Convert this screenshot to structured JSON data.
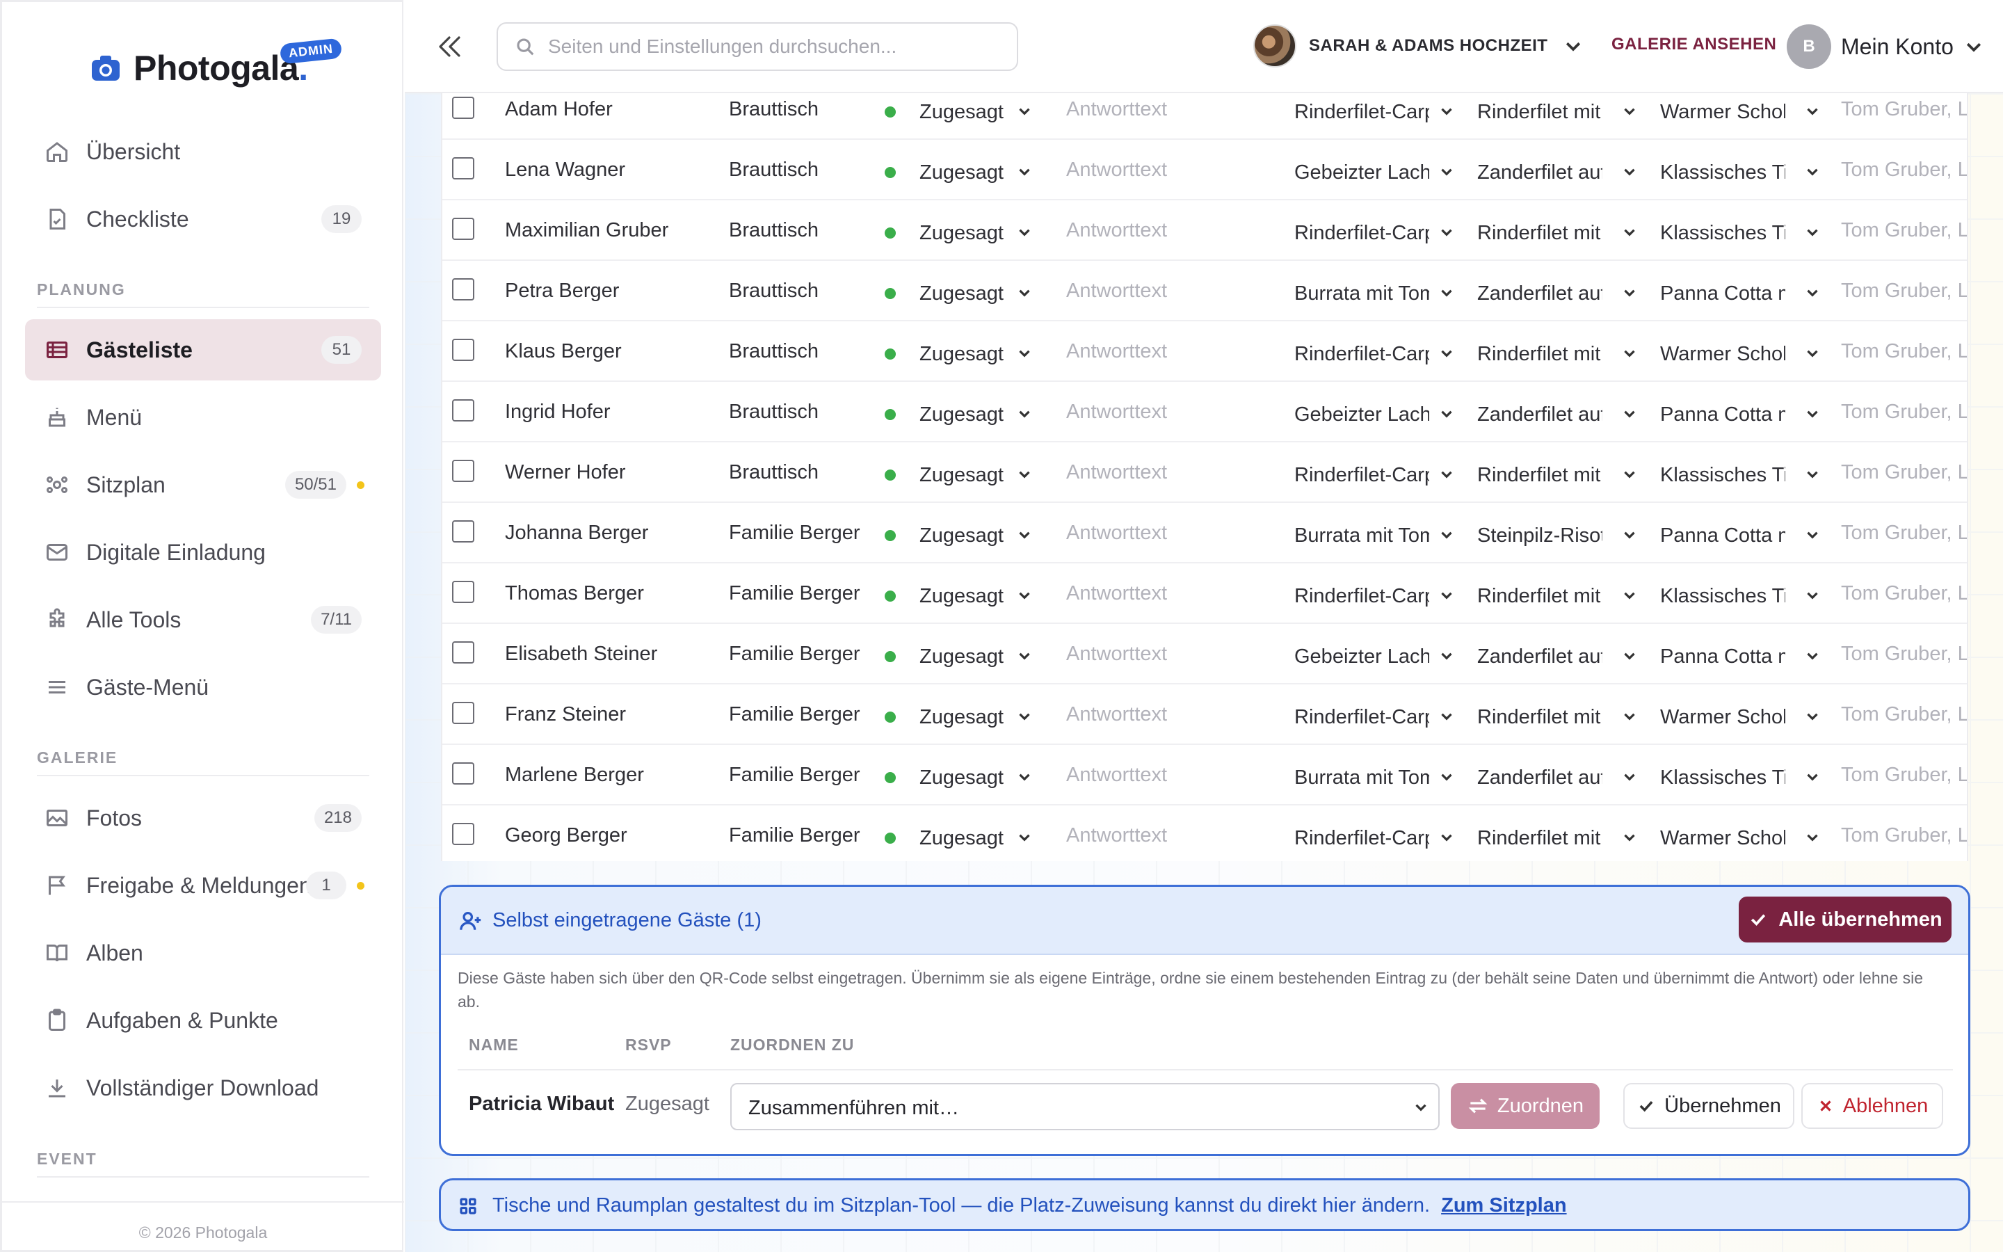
{
  "app": {
    "name": "Photogala",
    "badge": "ADMIN",
    "copyright": "© 2026 Photogala"
  },
  "colors": {
    "brand": "#7a2240",
    "accent_blue": "#2e63d0",
    "status_green": "#3aae4a",
    "notice_dot": "#f3c41a"
  },
  "sidebar": {
    "items": [
      {
        "label": "Übersicht",
        "icon": "home-icon"
      },
      {
        "label": "Checkliste",
        "icon": "checklist-icon",
        "count": "19"
      },
      {
        "label": "Gästeliste",
        "icon": "table-icon",
        "count": "51",
        "active": true
      },
      {
        "label": "Menü",
        "icon": "cake-icon"
      },
      {
        "label": "Sitzplan",
        "icon": "people-icon",
        "count": "50/51",
        "dot": true
      },
      {
        "label": "Digitale Einladung",
        "icon": "mail-icon"
      },
      {
        "label": "Alle Tools",
        "icon": "puzzle-icon",
        "count": "7/11"
      },
      {
        "label": "Gäste-Menü",
        "icon": "menu-icon"
      },
      {
        "label": "Fotos",
        "icon": "image-icon",
        "count": "218"
      },
      {
        "label": "Freigabe & Meldungen",
        "icon": "flag-icon",
        "count": "1",
        "dot": true
      },
      {
        "label": "Alben",
        "icon": "book-icon"
      },
      {
        "label": "Aufgaben & Punkte",
        "icon": "clipboard-icon"
      },
      {
        "label": "Vollständiger Download",
        "icon": "download-icon"
      }
    ],
    "sections": {
      "planung": "PLANUNG",
      "galerie": "GALERIE",
      "event": "EVENT"
    }
  },
  "topbar": {
    "search_placeholder": "Seiten und Einstellungen durchsuchen...",
    "event_name": "SARAH & ADAMS HOCHZEIT",
    "gallery_link": "GALERIE ANSEHEN",
    "account_initial": "B",
    "account_label": "Mein Konto"
  },
  "guests": {
    "response_placeholder": "Antworttext",
    "rows": [
      {
        "name": "Adam Hofer",
        "table": "Brauttisch",
        "rsvp": "Zugesagt",
        "starter": "Rinderfilet-Carpaccio",
        "main": "Rinderfilet mit",
        "dessert": "Warmer Schokokuchen",
        "companions": "Tom Gruber, Lisa"
      },
      {
        "name": "Lena Wagner",
        "table": "Brauttisch",
        "rsvp": "Zugesagt",
        "starter": "Gebeizter Lachs",
        "main": "Zanderfilet auf",
        "dessert": "Klassisches Tiramisu",
        "companions": "Tom Gruber, Lisa"
      },
      {
        "name": "Maximilian Gruber",
        "table": "Brauttisch",
        "rsvp": "Zugesagt",
        "starter": "Rinderfilet-Carpaccio",
        "main": "Rinderfilet mit",
        "dessert": "Klassisches Tiramisu",
        "companions": "Tom Gruber, Lisa"
      },
      {
        "name": "Petra Berger",
        "table": "Brauttisch",
        "rsvp": "Zugesagt",
        "starter": "Burrata mit Tomaten",
        "main": "Zanderfilet auf",
        "dessert": "Panna Cotta mit",
        "companions": "Tom Gruber, Lisa"
      },
      {
        "name": "Klaus Berger",
        "table": "Brauttisch",
        "rsvp": "Zugesagt",
        "starter": "Rinderfilet-Carpaccio",
        "main": "Rinderfilet mit",
        "dessert": "Warmer Schokokuchen",
        "companions": "Tom Gruber, Lisa"
      },
      {
        "name": "Ingrid Hofer",
        "table": "Brauttisch",
        "rsvp": "Zugesagt",
        "starter": "Gebeizter Lachs",
        "main": "Zanderfilet auf",
        "dessert": "Panna Cotta mit",
        "companions": "Tom Gruber, Lisa"
      },
      {
        "name": "Werner Hofer",
        "table": "Brauttisch",
        "rsvp": "Zugesagt",
        "starter": "Rinderfilet-Carpaccio",
        "main": "Rinderfilet mit",
        "dessert": "Klassisches Tiramisu",
        "companions": "Tom Gruber, Lisa"
      },
      {
        "name": "Johanna Berger",
        "table": "Familie Berger",
        "rsvp": "Zugesagt",
        "starter": "Burrata mit Tomaten",
        "main": "Steinpilz-Risotto",
        "dessert": "Panna Cotta mit",
        "companions": "Tom Gruber, Lisa"
      },
      {
        "name": "Thomas Berger",
        "table": "Familie Berger",
        "rsvp": "Zugesagt",
        "starter": "Rinderfilet-Carpaccio",
        "main": "Rinderfilet mit",
        "dessert": "Klassisches Tiramisu",
        "companions": "Tom Gruber, Lisa"
      },
      {
        "name": "Elisabeth Steiner",
        "table": "Familie Berger",
        "rsvp": "Zugesagt",
        "starter": "Gebeizter Lachs",
        "main": "Zanderfilet auf",
        "dessert": "Panna Cotta mit",
        "companions": "Tom Gruber, Lisa"
      },
      {
        "name": "Franz Steiner",
        "table": "Familie Berger",
        "rsvp": "Zugesagt",
        "starter": "Rinderfilet-Carpaccio",
        "main": "Rinderfilet mit",
        "dessert": "Warmer Schokokuchen",
        "companions": "Tom Gruber, Lisa"
      },
      {
        "name": "Marlene Berger",
        "table": "Familie Berger",
        "rsvp": "Zugesagt",
        "starter": "Burrata mit Tomaten",
        "main": "Zanderfilet auf",
        "dessert": "Klassisches Tiramisu",
        "companions": "Tom Gruber, Lisa"
      },
      {
        "name": "Georg Berger",
        "table": "Familie Berger",
        "rsvp": "Zugesagt",
        "starter": "Rinderfilet-Carpaccio",
        "main": "Rinderfilet mit",
        "dessert": "Warmer Schokokuchen",
        "companions": "Tom Gruber, Lisa"
      }
    ]
  },
  "self_registered": {
    "title": "Selbst eingetragene Gäste (1)",
    "accept_all": "Alle übernehmen",
    "description": "Diese Gäste haben sich über den QR-Code selbst eingetragen. Übernimm sie als eigene Einträge, ordne sie einem bestehenden Eintrag zu (der behält seine Daten und übernimmt die Antwort) oder lehne sie ab.",
    "columns": [
      "NAME",
      "RSVP",
      "ZUORDNEN ZU"
    ],
    "guest": {
      "name": "Patricia Wibaut",
      "rsvp": "Zugesagt",
      "merge_select": "Zusammenführen mit…"
    },
    "assign_label": "Zuordnen",
    "take_label": "Übernehmen",
    "reject_label": "Ablehnen"
  },
  "info": {
    "text": "Tische und Raumplan gestaltest du im Sitzplan-Tool — die Platz-Zuweisung kannst du direkt hier ändern.",
    "link": "Zum Sitzplan"
  }
}
